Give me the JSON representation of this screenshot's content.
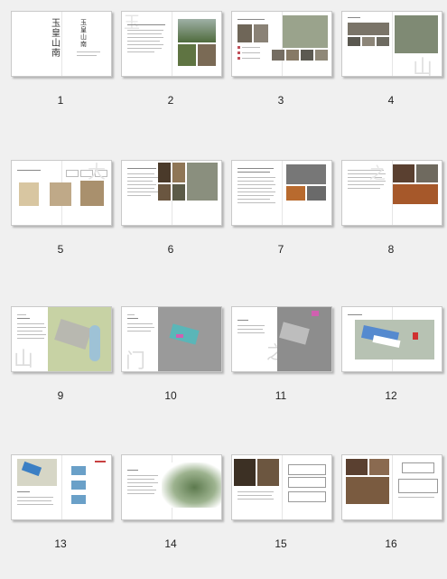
{
  "pages": [
    {
      "label": "1",
      "cover_title": "玉皇山南",
      "cover_title_small": "玉皇山南"
    },
    {
      "label": "2"
    },
    {
      "label": "3"
    },
    {
      "label": "4"
    },
    {
      "label": "5"
    },
    {
      "label": "6"
    },
    {
      "label": "7"
    },
    {
      "label": "8"
    },
    {
      "label": "9"
    },
    {
      "label": "10"
    },
    {
      "label": "11"
    },
    {
      "label": "12"
    },
    {
      "label": "13"
    },
    {
      "label": "14"
    },
    {
      "label": "15"
    },
    {
      "label": "16"
    }
  ]
}
